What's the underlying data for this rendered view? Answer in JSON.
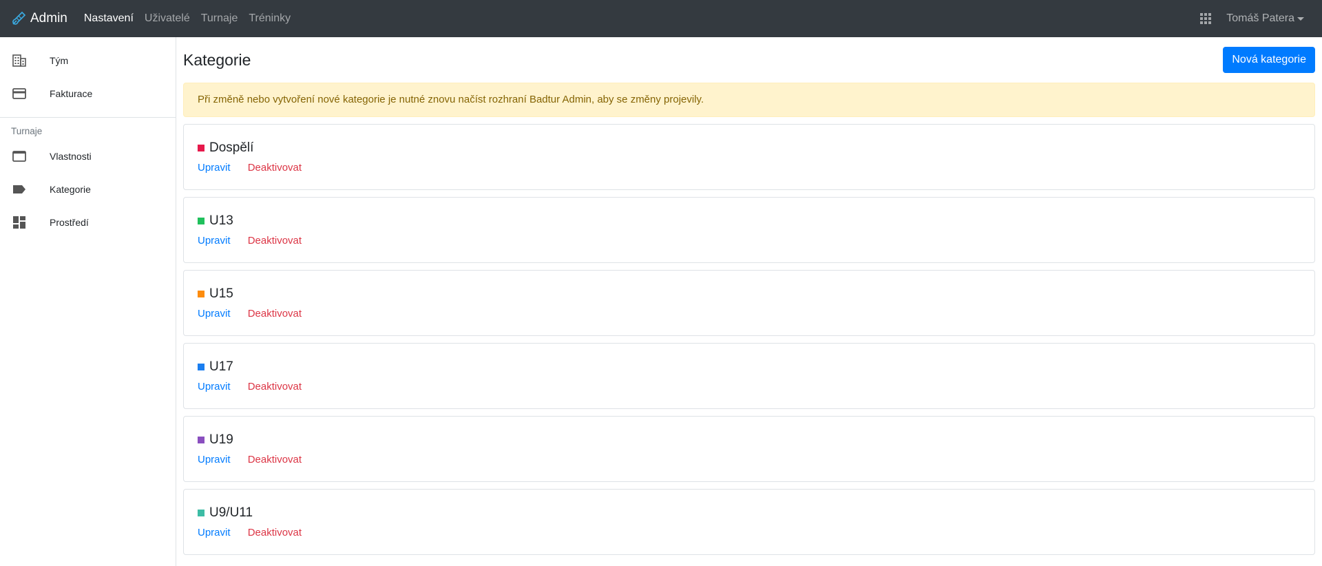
{
  "app": {
    "brand": "Admin"
  },
  "topnav": [
    {
      "label": "Nastavení",
      "active": true
    },
    {
      "label": "Uživatelé",
      "active": false
    },
    {
      "label": "Turnaje",
      "active": false
    },
    {
      "label": "Tréninky",
      "active": false
    }
  ],
  "user": {
    "name": "Tomáš Patera",
    "apps_icon": "apps-grid-icon"
  },
  "sidebar": {
    "items_top": [
      {
        "label": "Tým",
        "icon": "building-icon"
      },
      {
        "label": "Fakturace",
        "icon": "credit-card-icon"
      }
    ],
    "section_heading": "Turnaje",
    "items_section": [
      {
        "label": "Vlastnosti",
        "icon": "window-icon"
      },
      {
        "label": "Kategorie",
        "icon": "label-icon"
      },
      {
        "label": "Prostředí",
        "icon": "dashboard-icon"
      }
    ]
  },
  "page": {
    "title": "Kategorie",
    "new_button": "Nová kategorie",
    "alert": "Při změně nebo vytvoření nové kategorie je nutné znovu načíst rozhraní Badtur Admin, aby se změny projevily."
  },
  "actions": {
    "edit": "Upravit",
    "deactivate": "Deaktivovat"
  },
  "categories": [
    {
      "name": "Dospělí",
      "color": "#e6194b"
    },
    {
      "name": "U13",
      "color": "#20c05c"
    },
    {
      "name": "U15",
      "color": "#fd8c0e"
    },
    {
      "name": "U17",
      "color": "#1a7ef0"
    },
    {
      "name": "U19",
      "color": "#8a4fbf"
    },
    {
      "name": "U9/U11",
      "color": "#3dbca5"
    }
  ],
  "colors": {
    "primary": "#007bff",
    "danger": "#dc3545",
    "navbar": "#343a40",
    "alert_bg": "#fff3cd"
  }
}
